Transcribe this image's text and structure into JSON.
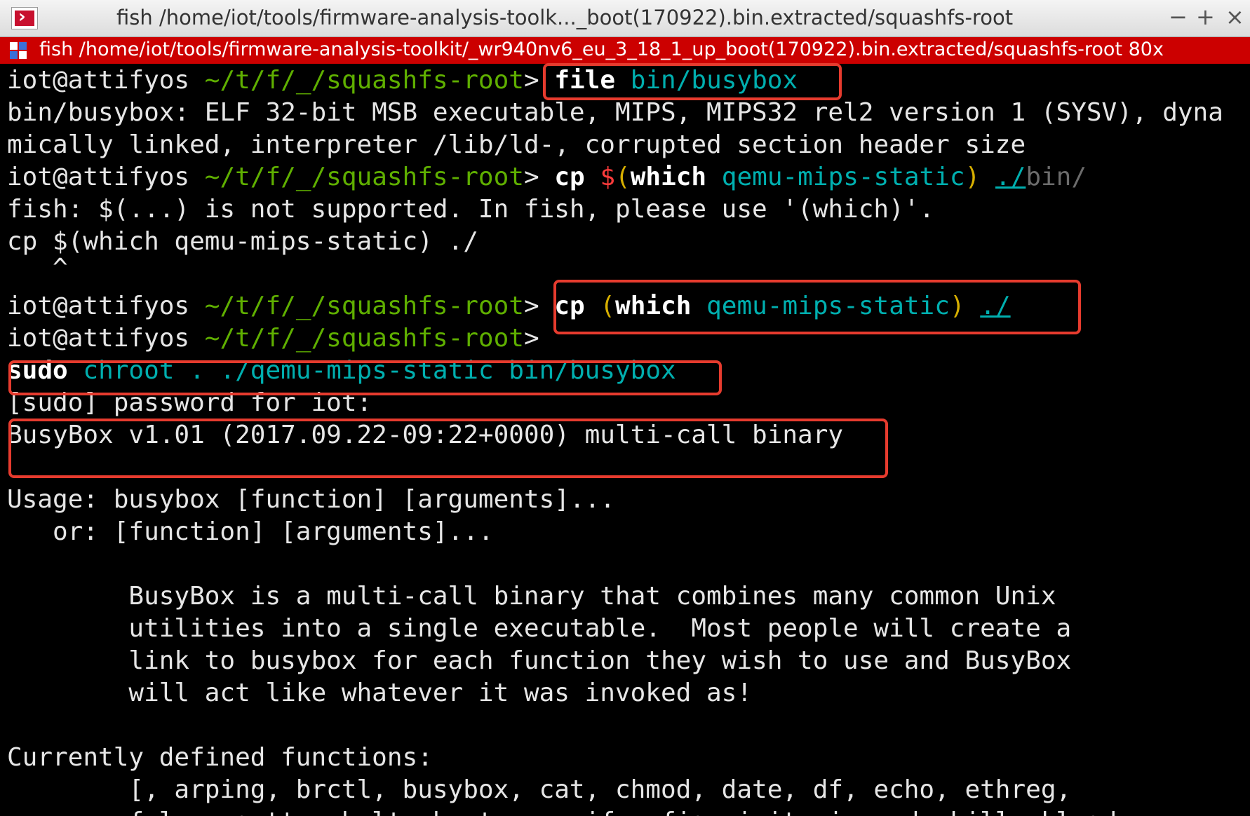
{
  "window": {
    "title": "fish  /home/iot/tools/firmware-analysis-toolk..._boot(170922).bin.extracted/squashfs-root",
    "minimize": "−",
    "maximize": "+",
    "close": "×"
  },
  "tab": {
    "label": "fish  /home/iot/tools/firmware-analysis-toolkit/_wr940nv6_eu_3_18_1_up_boot(170922).bin.extracted/squashfs-root 80x"
  },
  "prompt": {
    "user": "iot@attifyos",
    "path": "~/t/f/_/squashfs-root",
    "symbol": ">"
  },
  "cmd1": {
    "cmd": "file",
    "arg": "bin/busybox"
  },
  "out1": [
    "bin/busybox: ELF 32-bit MSB executable, MIPS, MIPS32 rel2 version 1 (SYSV), dyna",
    "mically linked, interpreter /lib/ld-, corrupted section header size"
  ],
  "cmd2": {
    "cmd": "cp",
    "dollar": "$",
    "open": "(",
    "which": "which",
    "arg": "qemu-mips-static",
    "close": ")",
    "dest": "./",
    "dest_suffix": "bin/"
  },
  "out2": [
    "fish: $(...) is not supported. In fish, please use '(which)'.",
    "cp $(which qemu-mips-static) ./",
    "   ^"
  ],
  "cmd3": {
    "cmd": "cp",
    "open": "(",
    "which": "which",
    "arg": "qemu-mips-static",
    "close": ")",
    "dest": "./"
  },
  "cmd4": {
    "sudo": "sudo",
    "rest": "chroot . ./qemu-mips-static bin/busybox"
  },
  "out4": {
    "sudo_prompt": "[sudo] password for iot:",
    "banner": "BusyBox v1.01 (2017.09.22-09:22+0000) multi-call binary",
    "usage1": "Usage: busybox [function] [arguments]...",
    "usage2": "   or: [function] [arguments]...",
    "desc": [
      "        BusyBox is a multi-call binary that combines many common Unix",
      "        utilities into a single executable.  Most people will create a",
      "        link to busybox for each function they wish to use and BusyBox",
      "        will act like whatever it was invoked as!"
    ],
    "functions_header": "Currently defined functions:",
    "functions_line": "        [, arping, brctl, busybox, cat, chmod, date, df, echo, ethreg,",
    "functions_partial": "        false, getty, halt, hostname, ifconfig, init, insmod, kill, klogd,"
  },
  "colors": {
    "highlight_box": "#e63b2e",
    "tab_bar": "#cc0000",
    "prompt_path": "#5faf00",
    "argument": "#00afaf",
    "paren": "#d7af00"
  }
}
